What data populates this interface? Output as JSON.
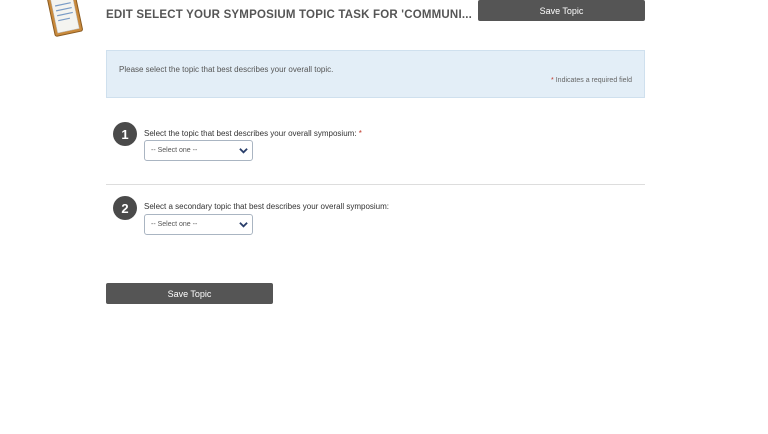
{
  "header": {
    "title": "EDIT SELECT YOUR SYMPOSIUM TOPIC TASK FOR 'COMMUNI...",
    "save_label": "Save Topic",
    "icon": "clipboard-icon"
  },
  "info": {
    "instruction": "Please select the topic that best describes your overall topic.",
    "required_star": "*",
    "required_note": " Indicates a required field"
  },
  "questions": [
    {
      "number": "1",
      "label": "Select the topic that best describes your overall symposium:",
      "required_star": "*",
      "selected": "-- Select one --"
    },
    {
      "number": "2",
      "label": "Select a secondary topic that best describes your overall symposium:",
      "selected": "-- Select one --"
    }
  ],
  "footer": {
    "save_label": "Save Topic"
  },
  "colors": {
    "button_bg": "#555555",
    "info_bg": "#e3eef7",
    "required": "#c0392b"
  }
}
